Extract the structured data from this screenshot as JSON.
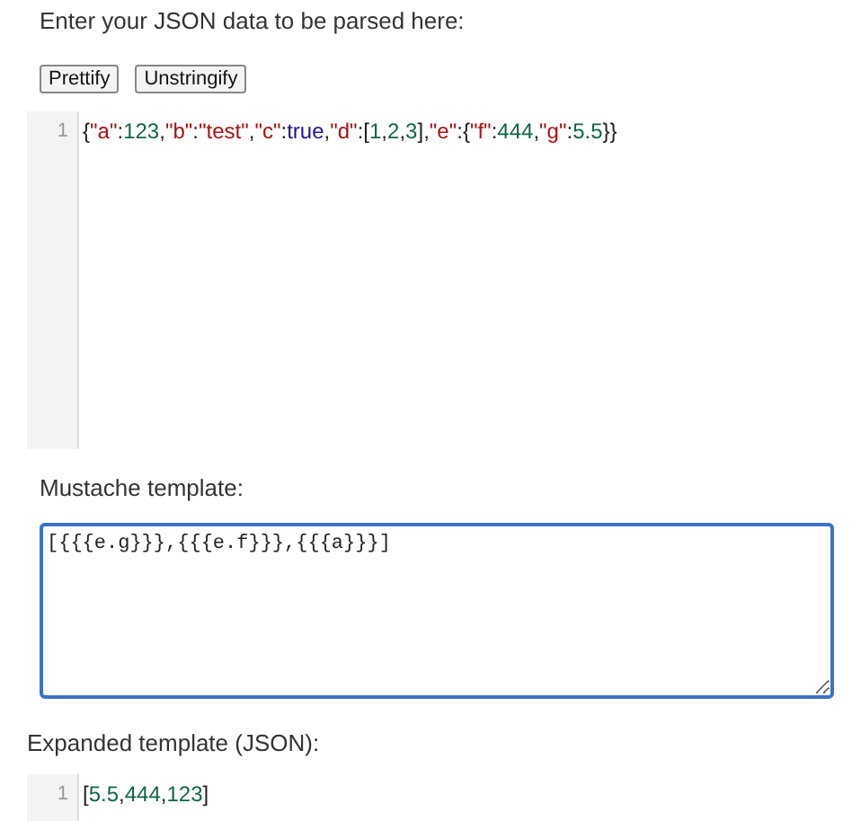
{
  "input_label": "Enter your JSON data to be parsed here:",
  "buttons": [
    "Prettify",
    "Unstringify"
  ],
  "json_editor": {
    "lines": [
      {
        "number": "1",
        "tokens": [
          {
            "text": "{",
            "kind": "punct"
          },
          {
            "text": "\"a\"",
            "kind": "string"
          },
          {
            "text": ":",
            "kind": "punct"
          },
          {
            "text": "123",
            "kind": "number"
          },
          {
            "text": ",",
            "kind": "punct"
          },
          {
            "text": "\"b\"",
            "kind": "string"
          },
          {
            "text": ":",
            "kind": "punct"
          },
          {
            "text": "\"test\"",
            "kind": "string"
          },
          {
            "text": ",",
            "kind": "punct"
          },
          {
            "text": "\"c\"",
            "kind": "string"
          },
          {
            "text": ":",
            "kind": "punct"
          },
          {
            "text": "true",
            "kind": "atom"
          },
          {
            "text": ",",
            "kind": "punct"
          },
          {
            "text": "\"d\"",
            "kind": "string"
          },
          {
            "text": ":[",
            "kind": "punct"
          },
          {
            "text": "1",
            "kind": "number"
          },
          {
            "text": ",",
            "kind": "punct"
          },
          {
            "text": "2",
            "kind": "number"
          },
          {
            "text": ",",
            "kind": "punct"
          },
          {
            "text": "3",
            "kind": "number"
          },
          {
            "text": "],",
            "kind": "punct"
          },
          {
            "text": "\"e\"",
            "kind": "string"
          },
          {
            "text": ":{",
            "kind": "punct"
          },
          {
            "text": "\"f\"",
            "kind": "string"
          },
          {
            "text": ":",
            "kind": "punct"
          },
          {
            "text": "444",
            "kind": "number"
          },
          {
            "text": ",",
            "kind": "punct"
          },
          {
            "text": "\"g\"",
            "kind": "string"
          },
          {
            "text": ":",
            "kind": "punct"
          },
          {
            "text": "5.5",
            "kind": "number"
          },
          {
            "text": "}}",
            "kind": "punct"
          }
        ]
      }
    ]
  },
  "template_label": "Mustache template:",
  "template": {
    "value": "[{{{e.g}}},{{{e.f}}},{{{a}}}]"
  },
  "output_label": "Expanded template (JSON):",
  "output_editor": {
    "lines": [
      {
        "number": "1",
        "tokens": [
          {
            "text": "[",
            "kind": "punct"
          },
          {
            "text": "5.5",
            "kind": "number"
          },
          {
            "text": ",",
            "kind": "punct"
          },
          {
            "text": "444",
            "kind": "number"
          },
          {
            "text": ",",
            "kind": "punct"
          },
          {
            "text": "123",
            "kind": "number"
          },
          {
            "text": "]",
            "kind": "punct"
          }
        ]
      }
    ]
  }
}
